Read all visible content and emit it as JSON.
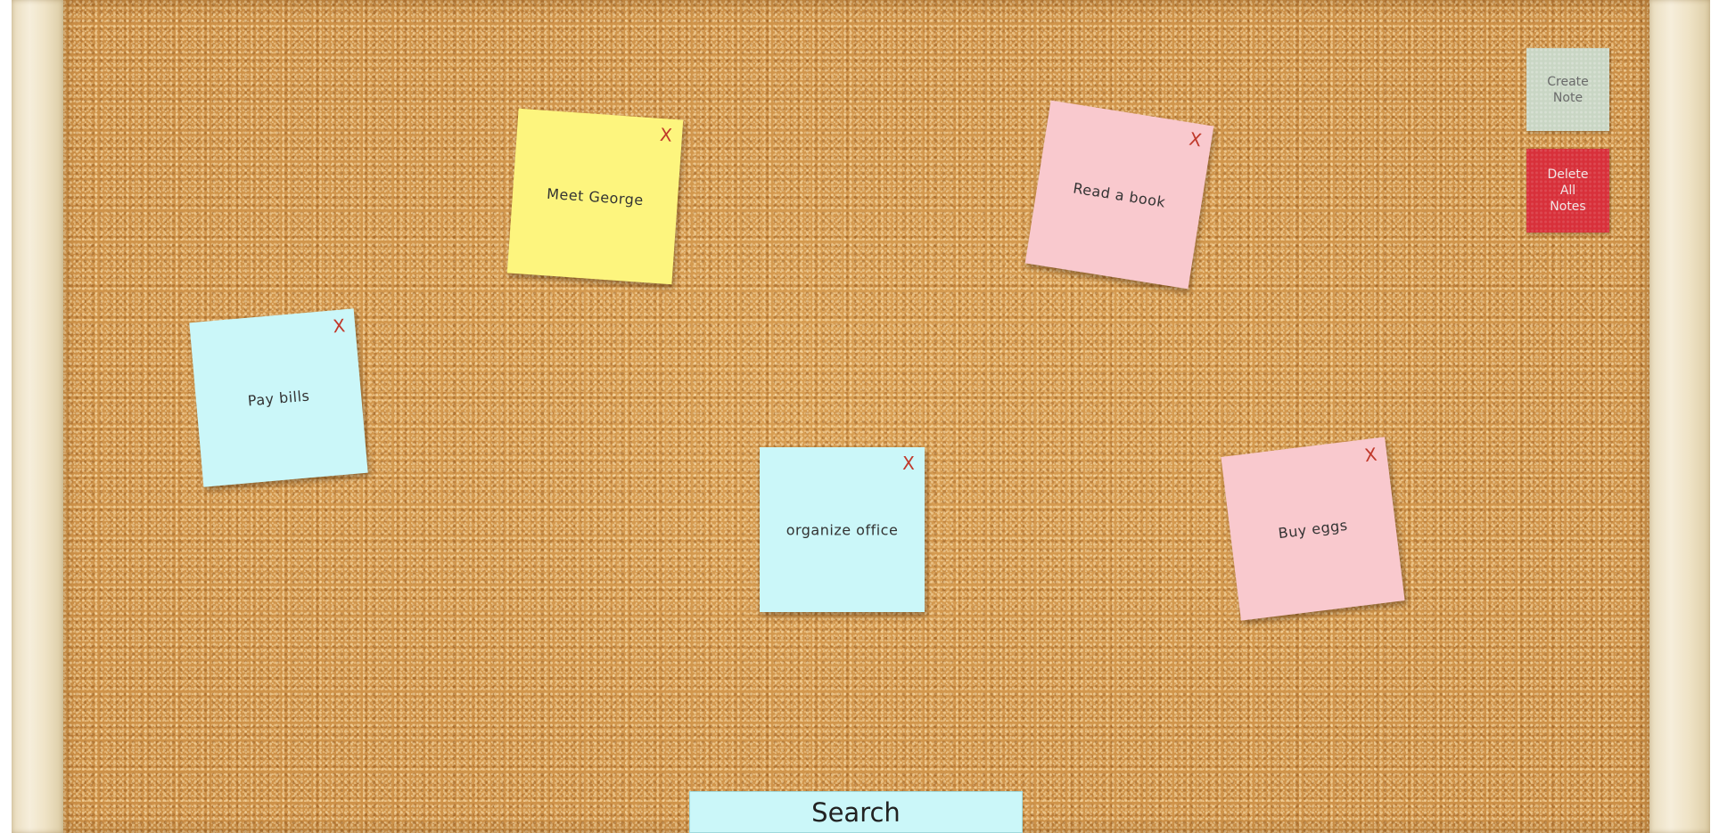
{
  "colors": {
    "note_yellow": "#fdf57e",
    "note_pink": "#f9c9ce",
    "note_cyan": "#cbf7f9",
    "close_x": "#c0392b",
    "create_button": "#c9d6c4",
    "delete_button": "#d8303a"
  },
  "notes": [
    {
      "text": "Meet George",
      "close": "X",
      "color": "#fdf57e"
    },
    {
      "text": "Read a book",
      "close": "X",
      "color": "#f9c9ce"
    },
    {
      "text": "Pay bills",
      "close": "X",
      "color": "#cbf7f9"
    },
    {
      "text": "organize office",
      "close": "X",
      "color": "#cbf7f9"
    },
    {
      "text": "Buy eggs",
      "close": "X",
      "color": "#f9c9ce"
    }
  ],
  "toolbar": {
    "create_label": "Create\nNote",
    "delete_label": "Delete\nAll\nNotes"
  },
  "search": {
    "label": "Search"
  }
}
